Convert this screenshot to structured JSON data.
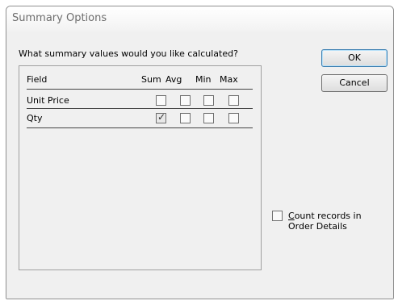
{
  "dialog": {
    "title": "Summary Options",
    "prompt": "What summary values would you like calculated?"
  },
  "table": {
    "headers": [
      "Field",
      "Sum",
      "Avg",
      "Min",
      "Max"
    ],
    "rows": [
      {
        "field": "Unit Price",
        "sum": false,
        "avg": false,
        "min": false,
        "max": false
      },
      {
        "field": "Qty",
        "sum": true,
        "avg": false,
        "min": false,
        "max": false
      }
    ]
  },
  "buttons": {
    "ok": "OK",
    "cancel": "Cancel"
  },
  "count_records": {
    "checked": false,
    "mnemonic": "C",
    "label_line1_rest": "ount records in",
    "label_line2": "Order Details"
  }
}
